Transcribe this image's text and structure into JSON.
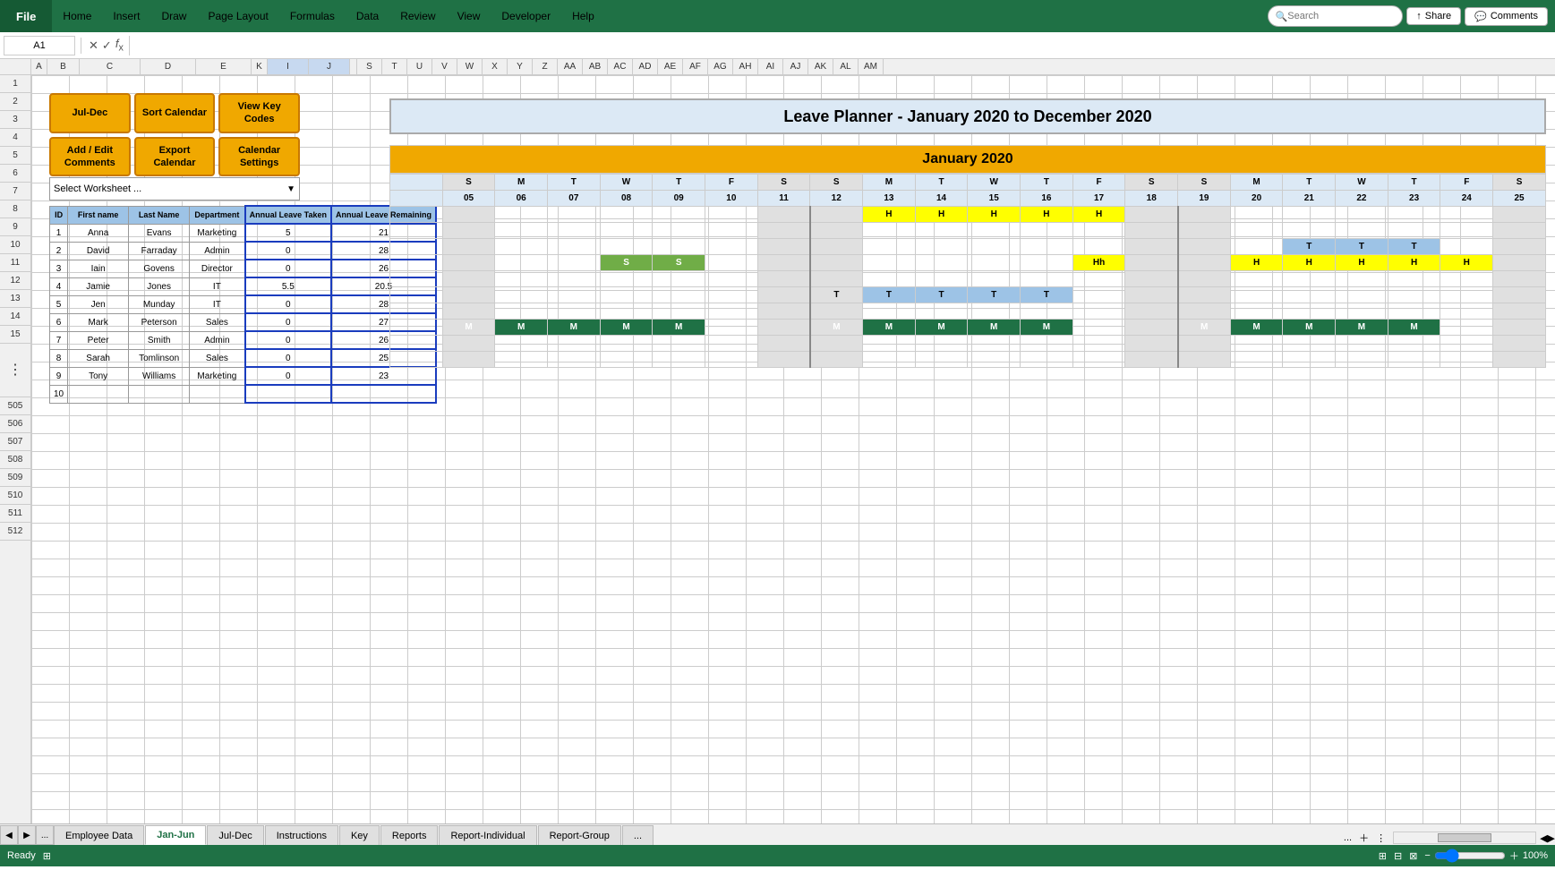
{
  "menubar": {
    "file_label": "File",
    "items": [
      "Home",
      "Insert",
      "Draw",
      "Page Layout",
      "Formulas",
      "Data",
      "Review",
      "View",
      "Developer",
      "Help"
    ],
    "search_placeholder": "Search",
    "share_label": "Share",
    "comments_label": "Comments"
  },
  "formula_bar": {
    "cell_ref": "A1",
    "formula_value": ""
  },
  "buttons": {
    "jul_dec": "Jul-Dec",
    "sort_calendar": "Sort Calendar",
    "view_key_codes": "View Key Codes",
    "add_edit_comments": "Add / Edit Comments",
    "export_calendar": "Export Calendar",
    "calendar_settings": "Calendar Settings"
  },
  "worksheet_select": {
    "label": "Select Worksheet ...",
    "placeholder": "Select Worksheet ..."
  },
  "title": "Leave Planner - January 2020 to December 2020",
  "month_header": "January 2020",
  "table": {
    "headers": [
      "ID",
      "First name",
      "Last Name",
      "Department",
      "Annual Leave Taken",
      "Annual Leave Remaining"
    ],
    "rows": [
      [
        1,
        "Anna",
        "Evans",
        "Marketing",
        5,
        21
      ],
      [
        2,
        "David",
        "Farraday",
        "Admin",
        0,
        28
      ],
      [
        3,
        "Iain",
        "Govens",
        "Director",
        0,
        26
      ],
      [
        4,
        "Jamie",
        "Jones",
        "IT",
        5.5,
        20.5
      ],
      [
        5,
        "Jen",
        "Munday",
        "IT",
        0,
        28
      ],
      [
        6,
        "Mark",
        "Peterson",
        "Sales",
        0,
        27
      ],
      [
        7,
        "Peter",
        "Smith",
        "Admin",
        0,
        26
      ],
      [
        8,
        "Sarah",
        "Tomlinson",
        "Sales",
        0,
        25
      ],
      [
        9,
        "Tony",
        "Williams",
        "Marketing",
        0,
        23
      ],
      [
        10,
        "",
        "",
        "",
        "",
        ""
      ]
    ]
  },
  "calendar": {
    "day_headers": [
      "S",
      "M",
      "T",
      "W",
      "T",
      "F",
      "S",
      "S",
      "M",
      "T",
      "W",
      "T",
      "F",
      "S",
      "S",
      "M",
      "T",
      "W",
      "T",
      "F",
      "S"
    ],
    "week_nums": [
      "05",
      "06",
      "07",
      "08",
      "09",
      "10",
      "11",
      "12",
      "13",
      "14",
      "15",
      "16",
      "17",
      "18",
      "19",
      "20",
      "21",
      "22",
      "23",
      "24",
      "25"
    ],
    "rows": [
      {
        "id": 1,
        "name": "Anna",
        "cells": [
          "",
          "",
          "",
          "",
          "",
          "",
          "",
          "",
          "H",
          "H",
          "H",
          "H",
          "H",
          "",
          "",
          "",
          "",
          "",
          "",
          "",
          ""
        ]
      },
      {
        "id": 2,
        "name": "David",
        "cells": [
          "",
          "",
          "",
          "",
          "",
          "",
          "",
          "",
          "",
          "",
          "",
          "",
          "",
          "",
          "",
          "",
          "",
          "",
          "",
          "",
          ""
        ]
      },
      {
        "id": 3,
        "name": "Iain",
        "cells": [
          "",
          "",
          "",
          "",
          "",
          "",
          "",
          "",
          "",
          "",
          "",
          "",
          "",
          "",
          "",
          "",
          "T",
          "T",
          "T",
          "",
          ""
        ]
      },
      {
        "id": 4,
        "name": "Jamie",
        "cells": [
          "",
          "",
          "",
          "S",
          "S",
          "",
          "",
          "",
          "",
          "",
          "",
          "",
          "Hh",
          "",
          "",
          "H",
          "H",
          "H",
          "H",
          "H",
          ""
        ]
      },
      {
        "id": 5,
        "name": "Jen",
        "cells": [
          "",
          "",
          "",
          "",
          "",
          "",
          "",
          "",
          "",
          "",
          "",
          "",
          "",
          "",
          "",
          "",
          "",
          "",
          "",
          "",
          ""
        ]
      },
      {
        "id": 6,
        "name": "Mark",
        "cells": [
          "",
          "",
          "",
          "",
          "",
          "",
          "",
          "T",
          "T",
          "T",
          "T",
          "T",
          "",
          "",
          "",
          "",
          "",
          "",
          "",
          "",
          ""
        ]
      },
      {
        "id": 7,
        "name": "Peter",
        "cells": [
          "",
          "",
          "",
          "",
          "",
          "",
          "",
          "",
          "",
          "",
          "",
          "",
          "",
          "",
          "",
          "",
          "",
          "",
          "",
          "",
          ""
        ]
      },
      {
        "id": 8,
        "name": "Sarah",
        "cells": [
          "M",
          "M",
          "M",
          "M",
          "M",
          "",
          "",
          "M",
          "M",
          "M",
          "M",
          "M",
          "",
          "",
          "M",
          "M",
          "M",
          "M",
          "M",
          "",
          ""
        ]
      },
      {
        "id": 9,
        "name": "Tony",
        "cells": [
          "",
          "",
          "",
          "",
          "",
          "",
          "",
          "",
          "",
          "",
          "",
          "",
          "",
          "",
          "",
          "",
          "",
          "",
          "",
          "",
          ""
        ]
      },
      {
        "id": 10,
        "name": "",
        "cells": [
          "",
          "",
          "",
          "",
          "",
          "",
          "",
          "",
          "",
          "",
          "",
          "",
          "",
          "",
          "",
          "",
          "",
          "",
          "",
          "",
          ""
        ]
      }
    ]
  },
  "tabs": {
    "items": [
      "Employee Data",
      "Jan-Jun",
      "Jul-Dec",
      "Instructions",
      "Key",
      "Reports",
      "Report-Individual",
      "Report-Group"
    ],
    "active": "Jan-Jun",
    "more": "..."
  },
  "status": {
    "ready": "Ready",
    "zoom": "100%"
  },
  "row_numbers": [
    "1",
    "2",
    "3",
    "4",
    "5",
    "6",
    "7",
    "8",
    "9",
    "10",
    "11",
    "12",
    "13",
    "14",
    "15",
    "",
    "",
    "",
    "",
    "",
    "505",
    "506",
    "507",
    "508",
    "509",
    "510",
    "511",
    "512"
  ]
}
